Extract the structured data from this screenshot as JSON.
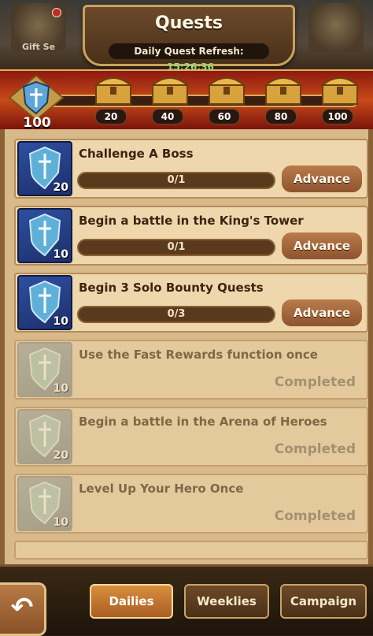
{
  "header": {
    "title": "Quests",
    "refresh_label": "Daily Quest Refresh:",
    "refresh_time": "15:26:36",
    "left_icon_label": "Gift Se",
    "right_icon_label": ""
  },
  "rewards": {
    "points": "100",
    "progress_fraction": 0.0,
    "chests": [
      "20",
      "40",
      "60",
      "80",
      "100"
    ]
  },
  "quests": [
    {
      "title": "Challenge A Boss",
      "points": "20",
      "progress": "0/1",
      "action": "Advance",
      "status": "active"
    },
    {
      "title": "Begin a battle in the King's Tower",
      "points": "10",
      "progress": "0/1",
      "action": "Advance",
      "status": "active"
    },
    {
      "title": "Begin 3 Solo Bounty Quests",
      "points": "10",
      "progress": "0/3",
      "action": "Advance",
      "status": "active"
    },
    {
      "title": "Use the Fast Rewards function once",
      "points": "10",
      "action": "Completed",
      "status": "done"
    },
    {
      "title": "Begin a battle in the Arena of Heroes",
      "points": "20",
      "action": "Completed",
      "status": "done"
    },
    {
      "title": "Level Up Your Hero Once",
      "points": "10",
      "action": "Completed",
      "status": "done"
    }
  ],
  "nav": {
    "back_symbol": "↶",
    "tabs": [
      "Dailies",
      "Weeklies",
      "Campaign"
    ],
    "active_tab": "Dailies"
  },
  "colors": {
    "accent": "#d88f3e",
    "timer": "#8ee07a",
    "badge_blue": "#2e4fa0"
  }
}
